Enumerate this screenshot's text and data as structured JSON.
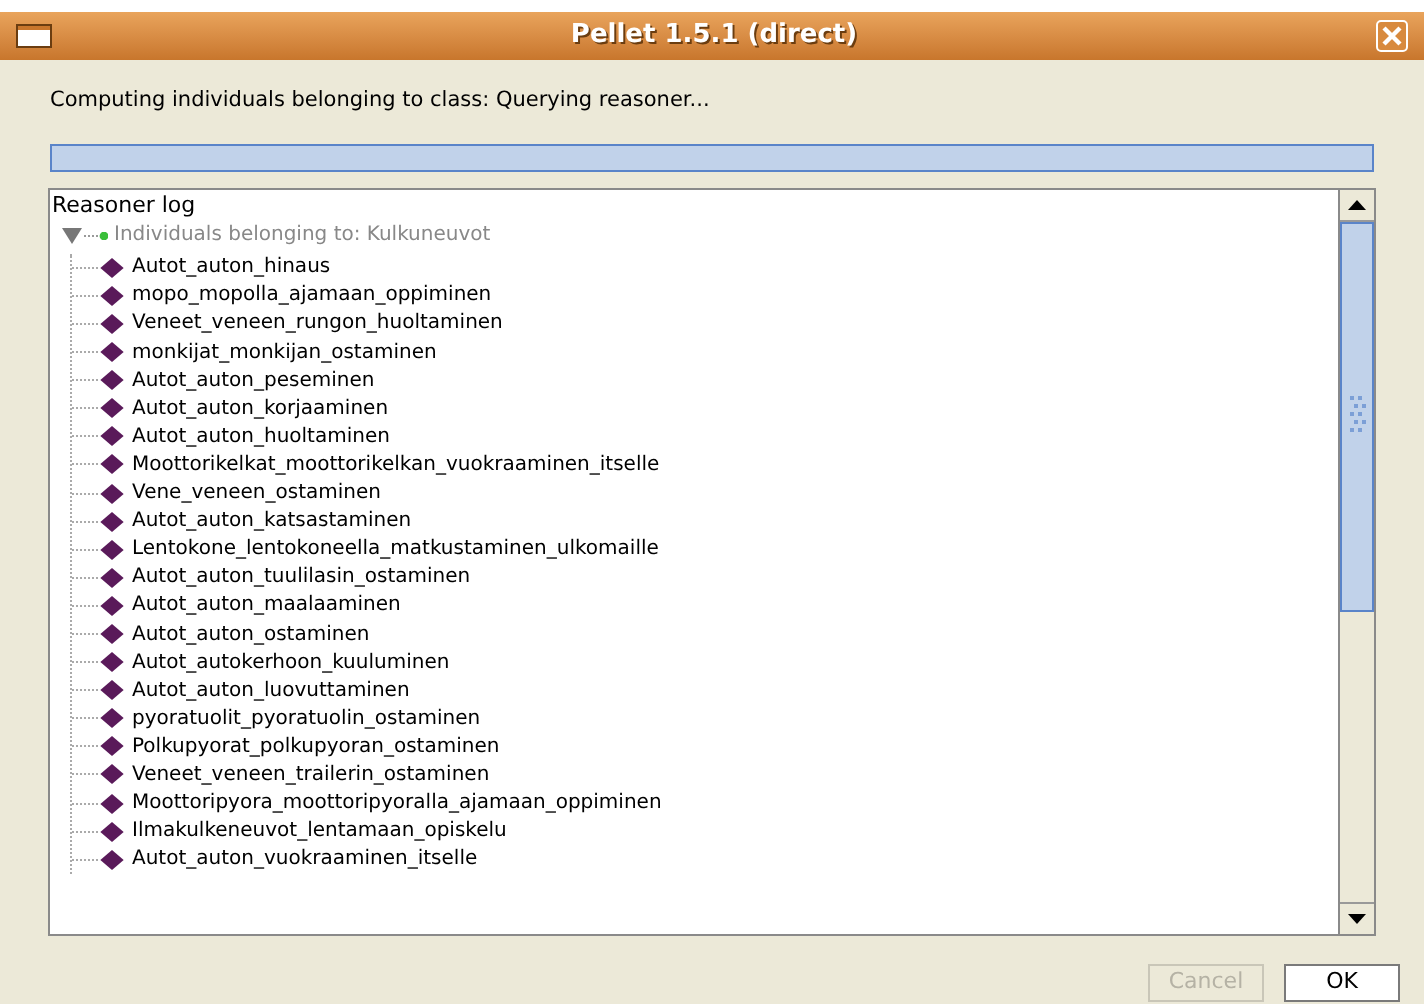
{
  "window": {
    "title": "Pellet 1.5.1 (direct)"
  },
  "status": "Computing individuals belonging to class: Querying reasoner...",
  "progress": {
    "level": 1
  },
  "log": {
    "title": "Reasoner log",
    "tree": {
      "label": "Individuals belonging to: Kulkuneuvot",
      "expanded": true,
      "children": [
        {
          "label": "Autot_auton_hinaus"
        },
        {
          "label": "mopo_mopolla_ajamaan_oppiminen"
        },
        {
          "label": "Veneet_veneen_rungon_huoltaminen"
        },
        {
          "label": "monkijat_monkijan_ostaminen"
        },
        {
          "label": "Autot_auton_peseminen"
        },
        {
          "label": "Autot_auton_korjaaminen"
        },
        {
          "label": "Autot_auton_huoltaminen"
        },
        {
          "label": "Moottorikelkat_moottorikelkan_vuokraaminen_itselle"
        },
        {
          "label": "Vene_veneen_ostaminen"
        },
        {
          "label": "Autot_auton_katsastaminen"
        },
        {
          "label": "Lentokone_lentokoneella_matkustaminen_ulkomaille"
        },
        {
          "label": "Autot_auton_tuulilasin_ostaminen"
        },
        {
          "label": "Autot_auton_maalaaminen"
        },
        {
          "label": "Autot_auton_ostaminen"
        },
        {
          "label": "Autot_autokerhoon_kuuluminen"
        },
        {
          "label": "Autot_auton_luovuttaminen"
        },
        {
          "label": "pyoratuolit_pyoratuolin_ostaminen"
        },
        {
          "label": "Polkupyorat_polkupyoran_ostaminen"
        },
        {
          "label": "Veneet_veneen_trailerin_ostaminen"
        },
        {
          "label": "Moottoripyora_moottoripyoralla_ajamaan_oppiminen"
        },
        {
          "label": "Ilmakulkeneuvot_lentamaan_opiskelu"
        },
        {
          "label": "Autot_auton_vuokraaminen_itselle"
        }
      ]
    }
  },
  "buttons": [
    {
      "label": "Cancel",
      "disabled": true
    },
    {
      "label": "OK",
      "disabled": false
    }
  ]
}
